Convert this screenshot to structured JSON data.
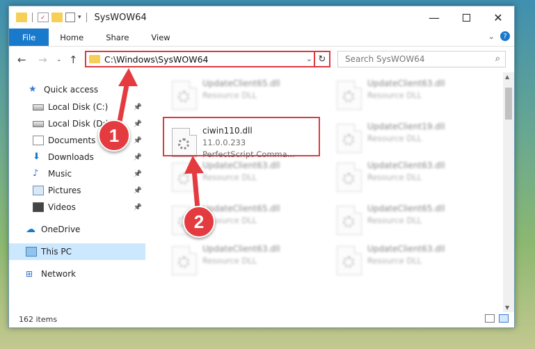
{
  "window": {
    "title": "SysWOW64"
  },
  "ribbon": {
    "tabs": [
      "File",
      "Home",
      "Share",
      "View"
    ]
  },
  "address": {
    "path": "C:\\Windows\\SysWOW64",
    "search_placeholder": "Search SysWOW64"
  },
  "nav": {
    "items": [
      {
        "label": "Quick access",
        "icon": "star-icon",
        "pinned": false
      },
      {
        "label": "Local Disk (C:)",
        "icon": "drive-icon",
        "pinned": true
      },
      {
        "label": "Local Disk (D:)",
        "icon": "drive-icon",
        "pinned": true
      },
      {
        "label": "Documents",
        "icon": "documents-icon",
        "pinned": true
      },
      {
        "label": "Downloads",
        "icon": "downloads-icon",
        "pinned": true
      },
      {
        "label": "Music",
        "icon": "music-icon",
        "pinned": true
      },
      {
        "label": "Pictures",
        "icon": "pictures-icon",
        "pinned": true
      },
      {
        "label": "Videos",
        "icon": "videos-icon",
        "pinned": true
      },
      {
        "label": "OneDrive",
        "icon": "cloud-icon",
        "pinned": false
      },
      {
        "label": "This PC",
        "icon": "pc-icon",
        "pinned": false,
        "selected": true
      },
      {
        "label": "Network",
        "icon": "network-icon",
        "pinned": false
      }
    ]
  },
  "files": {
    "col1": [
      {
        "name": "UpdateClient65.dll",
        "desc": "Resource DLL"
      },
      {
        "name": "ciwin110.dll",
        "version": "11.0.0.233",
        "desc": "PerfectScript Comma..."
      },
      {
        "name": "UpdateClient63.dll",
        "desc": "Resource DLL"
      },
      {
        "name": "UpdateClient65.dll",
        "desc": "Resource DLL"
      },
      {
        "name": "UpdateClient63.dll",
        "desc": "Resource DLL"
      }
    ],
    "col2": [
      {
        "name": "UpdateClient63.dll",
        "desc": "Resource DLL"
      },
      {
        "name": "UpdateClient19.dll",
        "desc": "Resource DLL"
      },
      {
        "name": "UpdateClient63.dll",
        "desc": "Resource DLL"
      },
      {
        "name": "UpdateClient65.dll",
        "desc": "Resource DLL"
      },
      {
        "name": "UpdateClient63.dll",
        "desc": "Resource DLL"
      }
    ]
  },
  "status": {
    "count": "162 items"
  },
  "markers": [
    "1",
    "2"
  ],
  "colors": {
    "accent": "#1979ca",
    "highlight": "#d9393f",
    "selected": "#cce8ff"
  }
}
